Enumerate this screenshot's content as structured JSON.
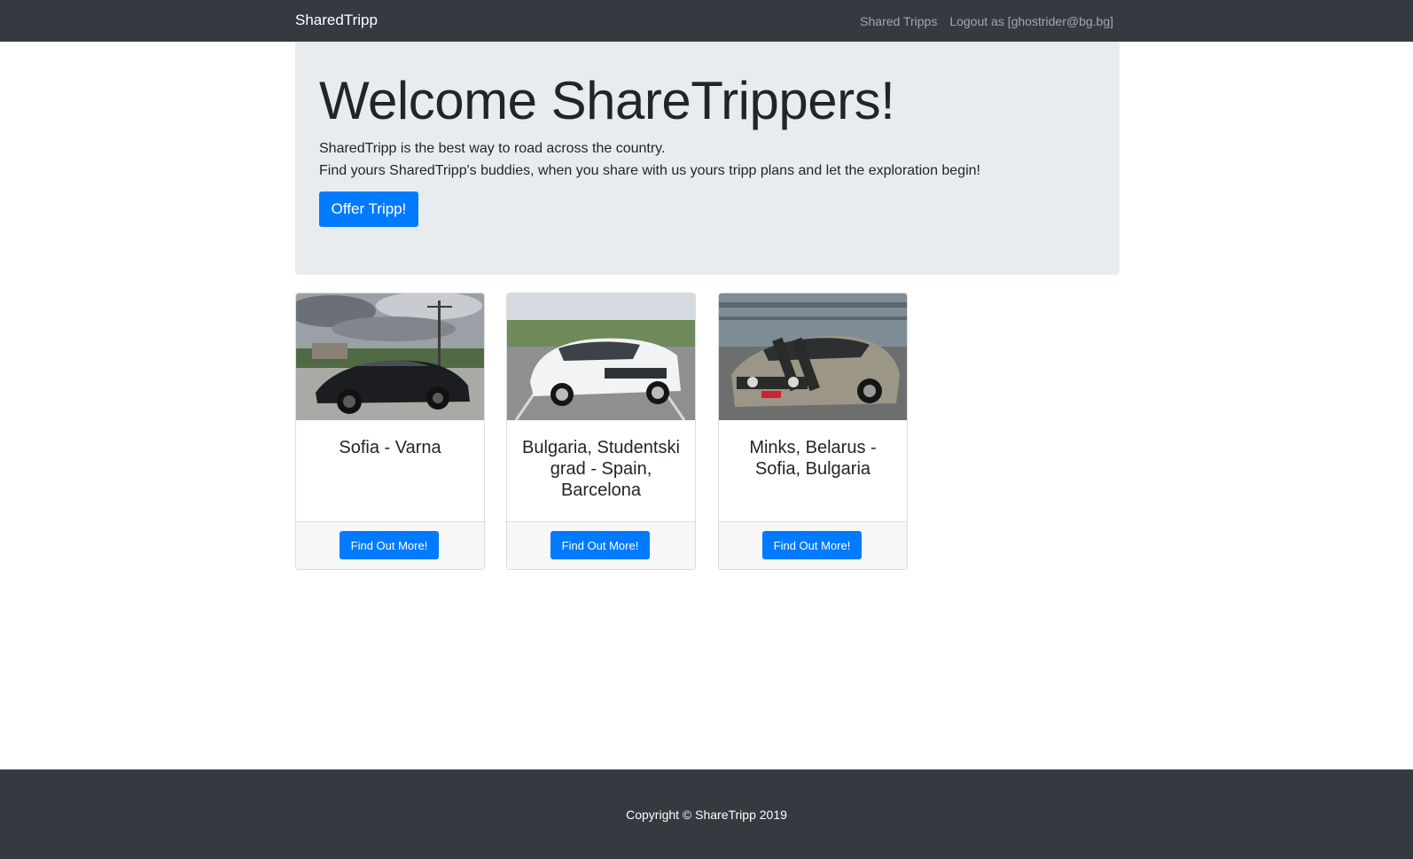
{
  "navbar": {
    "brand": "SharedTripp",
    "links": [
      "Shared Tripps",
      "Logout as [ghostrider@bg.bg]"
    ]
  },
  "jumbotron": {
    "title": "Welcome ShareTrippers!",
    "lead_1": "SharedTripp is the best way to road across the country.",
    "lead_2": "Find yours SharedTripp's buddies, when you share with us yours tripp plans and let the exploration begin!",
    "button": "Offer Tripp!"
  },
  "cards": [
    {
      "title": "Sofia - Varna",
      "button": "Find Out More!"
    },
    {
      "title": "Bulgaria, Studentski grad - Spain, Barcelona",
      "button": "Find Out More!"
    },
    {
      "title": "Minks, Belarus - Sofia, Bulgaria",
      "button": "Find Out More!"
    }
  ],
  "footer": {
    "copyright": "Copyright © ShareTripp 2019"
  },
  "colors": {
    "navbar": "#343a40",
    "primary": "#007bff",
    "jumbotron": "#e9ecef"
  }
}
